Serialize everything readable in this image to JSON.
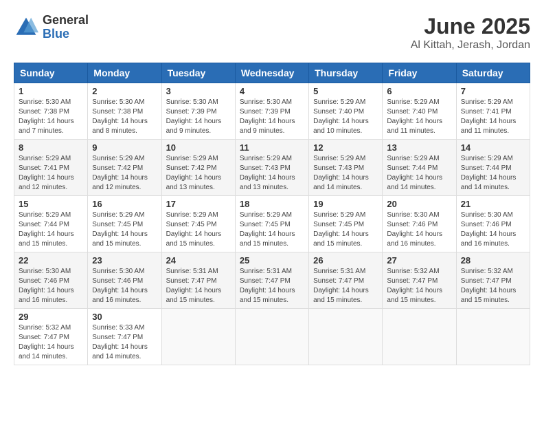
{
  "header": {
    "logo_general": "General",
    "logo_blue": "Blue",
    "title": "June 2025",
    "subtitle": "Al Kittah, Jerash, Jordan"
  },
  "calendar": {
    "days_of_week": [
      "Sunday",
      "Monday",
      "Tuesday",
      "Wednesday",
      "Thursday",
      "Friday",
      "Saturday"
    ],
    "weeks": [
      [
        {
          "day": "1",
          "sunrise": "5:30 AM",
          "sunset": "7:38 PM",
          "daylight": "14 hours and 7 minutes."
        },
        {
          "day": "2",
          "sunrise": "5:30 AM",
          "sunset": "7:38 PM",
          "daylight": "14 hours and 8 minutes."
        },
        {
          "day": "3",
          "sunrise": "5:30 AM",
          "sunset": "7:39 PM",
          "daylight": "14 hours and 9 minutes."
        },
        {
          "day": "4",
          "sunrise": "5:30 AM",
          "sunset": "7:39 PM",
          "daylight": "14 hours and 9 minutes."
        },
        {
          "day": "5",
          "sunrise": "5:29 AM",
          "sunset": "7:40 PM",
          "daylight": "14 hours and 10 minutes."
        },
        {
          "day": "6",
          "sunrise": "5:29 AM",
          "sunset": "7:40 PM",
          "daylight": "14 hours and 11 minutes."
        },
        {
          "day": "7",
          "sunrise": "5:29 AM",
          "sunset": "7:41 PM",
          "daylight": "14 hours and 11 minutes."
        }
      ],
      [
        {
          "day": "8",
          "sunrise": "5:29 AM",
          "sunset": "7:41 PM",
          "daylight": "14 hours and 12 minutes."
        },
        {
          "day": "9",
          "sunrise": "5:29 AM",
          "sunset": "7:42 PM",
          "daylight": "14 hours and 12 minutes."
        },
        {
          "day": "10",
          "sunrise": "5:29 AM",
          "sunset": "7:42 PM",
          "daylight": "14 hours and 13 minutes."
        },
        {
          "day": "11",
          "sunrise": "5:29 AM",
          "sunset": "7:43 PM",
          "daylight": "14 hours and 13 minutes."
        },
        {
          "day": "12",
          "sunrise": "5:29 AM",
          "sunset": "7:43 PM",
          "daylight": "14 hours and 14 minutes."
        },
        {
          "day": "13",
          "sunrise": "5:29 AM",
          "sunset": "7:44 PM",
          "daylight": "14 hours and 14 minutes."
        },
        {
          "day": "14",
          "sunrise": "5:29 AM",
          "sunset": "7:44 PM",
          "daylight": "14 hours and 14 minutes."
        }
      ],
      [
        {
          "day": "15",
          "sunrise": "5:29 AM",
          "sunset": "7:44 PM",
          "daylight": "14 hours and 15 minutes."
        },
        {
          "day": "16",
          "sunrise": "5:29 AM",
          "sunset": "7:45 PM",
          "daylight": "14 hours and 15 minutes."
        },
        {
          "day": "17",
          "sunrise": "5:29 AM",
          "sunset": "7:45 PM",
          "daylight": "14 hours and 15 minutes."
        },
        {
          "day": "18",
          "sunrise": "5:29 AM",
          "sunset": "7:45 PM",
          "daylight": "14 hours and 15 minutes."
        },
        {
          "day": "19",
          "sunrise": "5:29 AM",
          "sunset": "7:45 PM",
          "daylight": "14 hours and 15 minutes."
        },
        {
          "day": "20",
          "sunrise": "5:30 AM",
          "sunset": "7:46 PM",
          "daylight": "14 hours and 16 minutes."
        },
        {
          "day": "21",
          "sunrise": "5:30 AM",
          "sunset": "7:46 PM",
          "daylight": "14 hours and 16 minutes."
        }
      ],
      [
        {
          "day": "22",
          "sunrise": "5:30 AM",
          "sunset": "7:46 PM",
          "daylight": "14 hours and 16 minutes."
        },
        {
          "day": "23",
          "sunrise": "5:30 AM",
          "sunset": "7:46 PM",
          "daylight": "14 hours and 16 minutes."
        },
        {
          "day": "24",
          "sunrise": "5:31 AM",
          "sunset": "7:47 PM",
          "daylight": "14 hours and 15 minutes."
        },
        {
          "day": "25",
          "sunrise": "5:31 AM",
          "sunset": "7:47 PM",
          "daylight": "14 hours and 15 minutes."
        },
        {
          "day": "26",
          "sunrise": "5:31 AM",
          "sunset": "7:47 PM",
          "daylight": "14 hours and 15 minutes."
        },
        {
          "day": "27",
          "sunrise": "5:32 AM",
          "sunset": "7:47 PM",
          "daylight": "14 hours and 15 minutes."
        },
        {
          "day": "28",
          "sunrise": "5:32 AM",
          "sunset": "7:47 PM",
          "daylight": "14 hours and 15 minutes."
        }
      ],
      [
        {
          "day": "29",
          "sunrise": "5:32 AM",
          "sunset": "7:47 PM",
          "daylight": "14 hours and 14 minutes."
        },
        {
          "day": "30",
          "sunrise": "5:33 AM",
          "sunset": "7:47 PM",
          "daylight": "14 hours and 14 minutes."
        },
        null,
        null,
        null,
        null,
        null
      ]
    ],
    "labels": {
      "sunrise": "Sunrise:",
      "sunset": "Sunset:",
      "daylight": "Daylight:"
    }
  }
}
